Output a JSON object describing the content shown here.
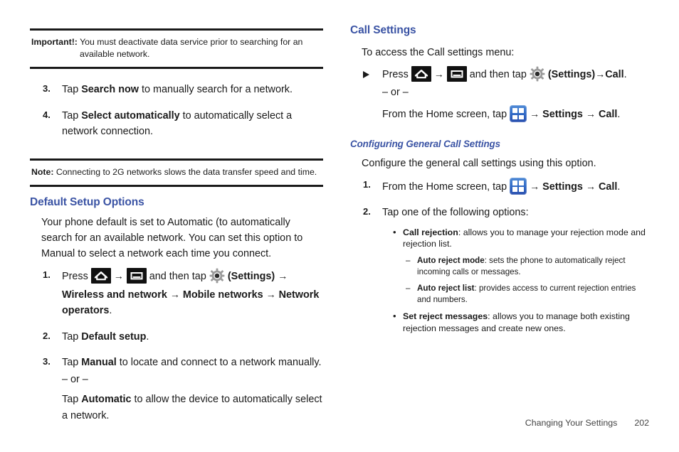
{
  "left": {
    "important": {
      "lead": "Important!:",
      "text": " You must deactivate data service prior to searching for an",
      "cont": "available network."
    },
    "steps_top": [
      {
        "num": "3.",
        "pre": "Tap ",
        "bold": "Search now",
        "post": " to manually search for a network."
      },
      {
        "num": "4.",
        "pre": "Tap ",
        "bold": "Select automatically",
        "post": " to automatically select a network connection."
      }
    ],
    "note": {
      "lead": "Note:",
      "text": " Connecting to 2G networks slows the data transfer speed and time."
    },
    "heading": "Default Setup Options",
    "intro": "Your phone default is set to Automatic (to automatically search for an available network. You can set this option to Manual to select a network each time you connect.",
    "step1": {
      "num": "1.",
      "press": "Press",
      "and_then_tap": "and then tap",
      "settings_label": "(Settings)",
      "path1": "Wireless and network",
      "path2": "Mobile networks",
      "path3": "Network operators",
      "period": "."
    },
    "step2": {
      "num": "2.",
      "pre": "Tap ",
      "bold": "Default setup",
      "post": "."
    },
    "step3": {
      "num": "3.",
      "pre": "Tap ",
      "bold": "Manual",
      "post": " to locate and connect to a network manually.",
      "or": "– or –",
      "alt_pre": "Tap ",
      "alt_bold": "Automatic",
      "alt_post": " to allow the device to automatically select a network."
    }
  },
  "right": {
    "heading": "Call Settings",
    "intro": "To access the Call settings menu:",
    "access": {
      "press": "Press",
      "and_then_tap": "and then tap",
      "settings_label": "(Settings)",
      "call": "Call",
      "period": ".",
      "or": "– or –",
      "home_pre": "From the Home screen, tap",
      "settings_word": "Settings",
      "call_word": "Call"
    },
    "subheading": "Configuring General Call Settings",
    "sub_intro": "Configure the general call settings using this option.",
    "step1": {
      "num": "1.",
      "pre": "From the Home screen, tap",
      "settings_word": "Settings",
      "call_word": "Call",
      "period": "."
    },
    "step2": {
      "num": "2.",
      "text": "Tap one of the following options:"
    },
    "options": [
      {
        "kind": "bullet",
        "bold": "Call rejection",
        "text": ": allows you to manage your rejection mode and rejection list."
      },
      {
        "kind": "dash",
        "bold": "Auto reject mode",
        "text": ": sets the phone to automatically reject incoming calls or messages."
      },
      {
        "kind": "dash",
        "bold": "Auto reject list",
        "text": ": provides access to current rejection entries and numbers."
      },
      {
        "kind": "bullet",
        "bold": "Set reject messages",
        "text": ": allows you to manage both existing rejection messages and create new ones."
      }
    ]
  },
  "footer": {
    "section": "Changing Your Settings",
    "page": "202"
  },
  "colors": {
    "heading_blue": "#3a53a4",
    "apps_icon_blue": "#2f67c4",
    "rule_black": "#1a1a1a"
  },
  "arrow": "→"
}
